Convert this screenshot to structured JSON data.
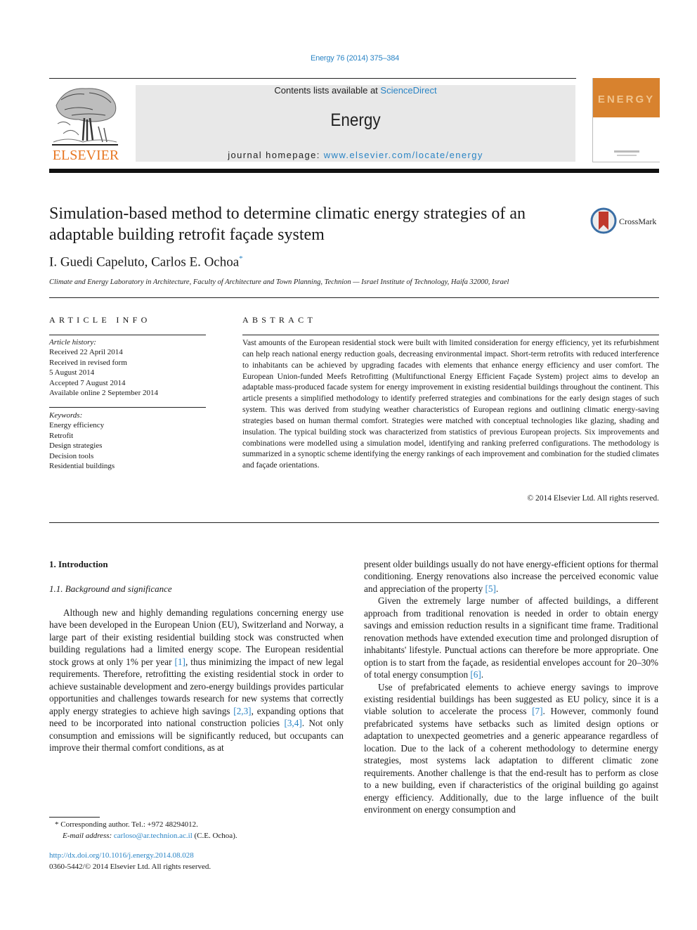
{
  "header": {
    "journal_ref": "Energy 76 (2014) 375–384",
    "contents_prefix": "Contents lists available at ",
    "contents_link": "ScienceDirect",
    "journal_name": "Energy",
    "homepage_prefix": "journal homepage: ",
    "homepage_link": "www.elsevier.com/locate/energy",
    "publisher_logo": "ELSEVIER",
    "cover_word": "ENERGY"
  },
  "colors": {
    "link": "#2a84c5",
    "elsevier_orange": "#e87722",
    "cover_orange": "#d8822e",
    "masthead_bg": "#e8e8e8"
  },
  "article": {
    "title": "Simulation-based method to determine climatic energy strategies of an adaptable building retrofit façade system",
    "crossmark_label": "CrossMark",
    "authors": "I. Guedi Capeluto, Carlos E. Ochoa",
    "author_mark": "*",
    "affiliation": "Climate and Energy Laboratory in Architecture, Faculty of Architecture and Town Planning, Technion — Israel Institute of Technology, Haifa 32000, Israel"
  },
  "article_info": {
    "heading": "ARTICLE INFO",
    "history_label": "Article history:",
    "history": [
      "Received 22 April 2014",
      "Received in revised form",
      "5 August 2014",
      "Accepted 7 August 2014",
      "Available online 2 September 2014"
    ],
    "keywords_label": "Keywords:",
    "keywords": [
      "Energy efficiency",
      "Retrofit",
      "Design strategies",
      "Decision tools",
      "Residential buildings"
    ]
  },
  "abstract": {
    "heading": "ABSTRACT",
    "text": "Vast amounts of the European residential stock were built with limited consideration for energy efficiency, yet its refurbishment can help reach national energy reduction goals, decreasing environmental impact. Short-term retrofits with reduced interference to inhabitants can be achieved by upgrading facades with elements that enhance energy efficiency and user comfort. The European Union-funded Meefs Retrofitting (Multifunctional Energy Efficient Façade System) project aims to develop an adaptable mass-produced facade system for energy improvement in existing residential buildings throughout the continent. This article presents a simplified methodology to identify preferred strategies and combinations for the early design stages of such system. This was derived from studying weather characteristics of European regions and outlining climatic energy-saving strategies based on human thermal comfort. Strategies were matched with conceptual technologies like glazing, shading and insulation. The typical building stock was characterized from statistics of previous European projects. Six improvements and combinations were modelled using a simulation model, identifying and ranking preferred configurations. The methodology is summarized in a synoptic scheme identifying the energy rankings of each improvement and combination for the studied climates and façade orientations.",
    "copyright": "© 2014 Elsevier Ltd. All rights reserved."
  },
  "body": {
    "section_1": "1.  Introduction",
    "section_1_1": "1.1.  Background and significance",
    "left_col": {
      "p1_a": "Although new and highly demanding regulations concerning energy use have been developed in the European Union (EU), Switzerland and Norway, a large part of their existing residential building stock was constructed when building regulations had a limited energy scope. The European residential stock grows at only 1% per year ",
      "ref1": "[1]",
      "p1_b": ", thus minimizing the impact of new legal requirements. Therefore, retrofitting the existing residential stock in order to achieve sustainable development and zero-energy buildings provides particular opportunities and challenges towards research for new systems that correctly apply energy strategies to achieve high savings ",
      "ref2": "[2,3]",
      "p1_c": ", expanding options that need to be incorporated into national construction policies ",
      "ref3": "[3,4]",
      "p1_d": ". Not only consumption and emissions will be significantly reduced, but occupants can improve their thermal comfort conditions, as at"
    },
    "right_col": {
      "p0_a": "present older buildings usually do not have energy-efficient options for thermal conditioning. Energy renovations also increase the perceived economic value and appreciation of the property ",
      "ref5": "[5]",
      "p0_b": ".",
      "p2_a": "Given the extremely large number of affected buildings, a different approach from traditional renovation is needed in order to obtain energy savings and emission reduction results in a significant time frame. Traditional renovation methods have extended execution time and prolonged disruption of inhabitants' lifestyle. Punctual actions can therefore be more appropriate. One option is to start from the façade, as residential envelopes account for 20–30% of total energy consumption ",
      "ref6": "[6]",
      "p2_b": ".",
      "p3_a": "Use of prefabricated elements to achieve energy savings to improve existing residential buildings has been suggested as EU policy, since it is a viable solution to accelerate the process ",
      "ref7": "[7]",
      "p3_b": ". However, commonly found prefabricated systems have setbacks such as limited design options or adaptation to unexpected geometries and a generic appearance regardless of location. Due to the lack of a coherent methodology to determine energy strategies, most systems lack adaptation to different climatic zone requirements. Another challenge is that the end-result has to perform as close to a new building, even if characteristics of the original building go against energy efficiency. Additionally, due to the large influence of the built environment on energy consumption and"
    }
  },
  "footnotes": {
    "corresponding": "* Corresponding author. Tel.: +972 48294012.",
    "email_label": "E-mail address: ",
    "email": "carloso@ar.technion.ac.il",
    "email_suffix": " (C.E. Ochoa).",
    "doi": "http://dx.doi.org/10.1016/j.energy.2014.08.028",
    "issn": "0360-5442/© 2014 Elsevier Ltd. All rights reserved."
  }
}
